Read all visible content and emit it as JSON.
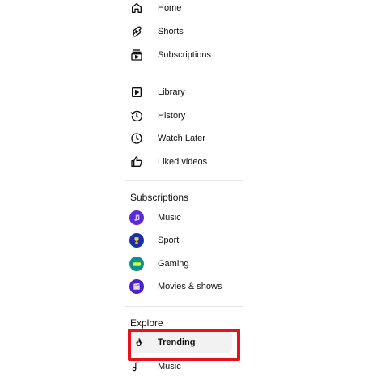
{
  "nav": {
    "primary": [
      {
        "label": "Home",
        "icon": "home-icon"
      },
      {
        "label": "Shorts",
        "icon": "shorts-icon"
      },
      {
        "label": "Subscriptions",
        "icon": "subscriptions-icon"
      }
    ],
    "library": [
      {
        "label": "Library",
        "icon": "library-icon"
      },
      {
        "label": "History",
        "icon": "history-icon"
      },
      {
        "label": "Watch Later",
        "icon": "watch-later-icon"
      },
      {
        "label": "Liked videos",
        "icon": "liked-videos-icon"
      }
    ]
  },
  "subscriptions": {
    "title": "Subscriptions",
    "items": [
      {
        "label": "Music",
        "icon": "music-channel-icon",
        "color": "#5b2bd6"
      },
      {
        "label": "Sport",
        "icon": "sport-channel-icon",
        "color": "#1d2fa8"
      },
      {
        "label": "Gaming",
        "icon": "gaming-channel-icon",
        "color": "#0f8f8f"
      },
      {
        "label": "Movies & shows",
        "icon": "movies-channel-icon",
        "color": "#4b22c7"
      }
    ]
  },
  "explore": {
    "title": "Explore",
    "items": [
      {
        "label": "Trending",
        "icon": "trending-flame-icon",
        "active": true
      },
      {
        "label": "Music",
        "icon": "music-note-icon"
      }
    ]
  },
  "colors": {
    "highlight": "#e8101a",
    "active_bg": "#f2f2f2",
    "divider": "#e5e5e5"
  }
}
